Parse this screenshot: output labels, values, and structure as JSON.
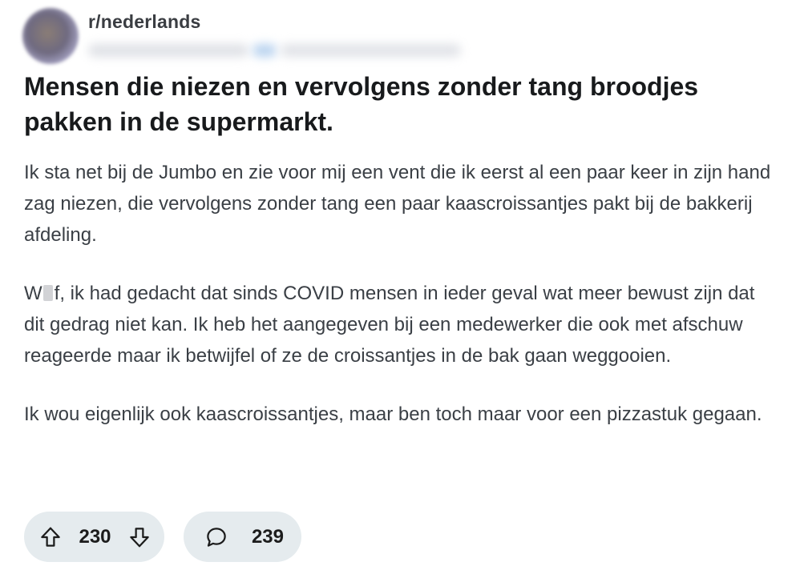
{
  "post": {
    "subreddit": "r/nederlands",
    "title": "Mensen die niezen en vervolgens zonder tang broodjes pakken in de supermarkt.",
    "paragraphs": [
      "Ik sta net bij de Jumbo en zie voor mij een vent die ik eerst al een paar keer in zijn hand zag niezen, die vervolgens zonder tang een paar kaascroissantjes pakt bij de bakkerij afdeling.",
      {
        "lead_letter": "W",
        "after_censor": "f, ik had gedacht dat sinds COVID mensen in ieder geval wat meer bewust zijn dat dit gedrag niet kan. Ik heb het aangegeven bij een medewerker die ook met afschuw reageerde maar ik betwijfel of ze de croissantjes in de bak gaan weggooien."
      },
      "Ik wou eigenlijk ook kaascroissantjes, maar ben toch maar voor een pizzastuk gegaan."
    ]
  },
  "actions": {
    "upvote_icon": "arrow-up-icon",
    "vote_count": "230",
    "downvote_icon": "arrow-down-icon",
    "comment_icon": "speech-bubble-icon",
    "comment_count": "239"
  },
  "colors": {
    "pill_background": "#e5ebee",
    "title_text": "#181a1c",
    "body_text": "#3a3f45",
    "subreddit_text": "#3a3d42"
  }
}
